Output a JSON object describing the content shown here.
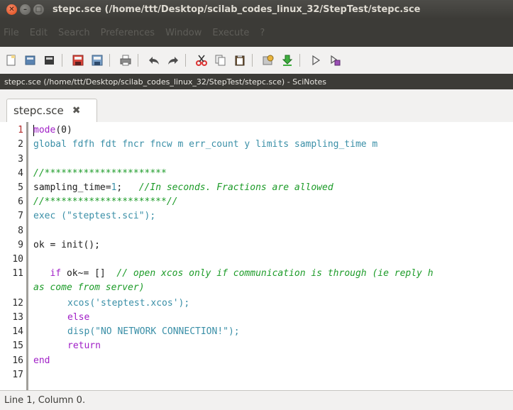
{
  "window": {
    "title": "stepc.sce (/home/ttt/Desktop/scilab_codes_linux_32/StepTest/stepc.sce",
    "close_glyph": "✕",
    "min_glyph": "–",
    "max_glyph": "□"
  },
  "menu": {
    "items": [
      "File",
      "Edit",
      "Search",
      "Preferences",
      "Window",
      "Execute",
      "?"
    ]
  },
  "toolbar": {
    "buttons": [
      "new-file-icon",
      "open-file-icon",
      "open-folder-icon",
      "save-icon",
      "save-as-icon",
      "print-icon",
      "undo-icon",
      "redo-icon",
      "cut-icon",
      "copy-icon",
      "paste-icon",
      "help-icon",
      "execute-to-console-icon",
      "run-icon",
      "run-all-icon"
    ]
  },
  "pathbar": {
    "text": "stepc.sce (/home/ttt/Desktop/scilab_codes_linux_32/StepTest/stepc.sce) - SciNotes"
  },
  "tab": {
    "label": "stepc.sce",
    "close_glyph": "✖"
  },
  "editor": {
    "line_numbers": [
      "1",
      "2",
      "3",
      "4",
      "5",
      "6",
      "7",
      "8",
      "9",
      "10",
      "11",
      "",
      "12",
      "13",
      "14",
      "15",
      "16",
      "17"
    ],
    "lines": {
      "l1_kw": "mode",
      "l1_rest": "(0)",
      "l2_kw": "global",
      "l2_rest": " fdfh fdt fncr fncw m err_count y limits sampling_time m",
      "l4": "//**********************",
      "l5_a": "sampling_time=",
      "l5_num": "1",
      "l5_b": ";   ",
      "l5_comment": "//In seconds. Fractions are allowed",
      "l6": "//**********************//",
      "l7_fn": "exec",
      "l7_rest": " (\"steptest.sci\");",
      "l9": "ok = init();    ",
      "l11_pre": "   ",
      "l11_kw": "if",
      "l11_mid": " ok~= [] ",
      "l11_comment": " // open xcos only if communication is through (ie reply h",
      "l11_wrap": "as come from server)",
      "l12_fn": "xcos",
      "l12_rest": "('steptest.xcos');",
      "l13_kw": "else",
      "l14_fn": "disp",
      "l14_rest": "(\"NO NETWORK CONNECTION!\");",
      "l15_kw": "return",
      "l16_kw": "end"
    }
  },
  "status": {
    "text": "Line 1, Column 0."
  }
}
